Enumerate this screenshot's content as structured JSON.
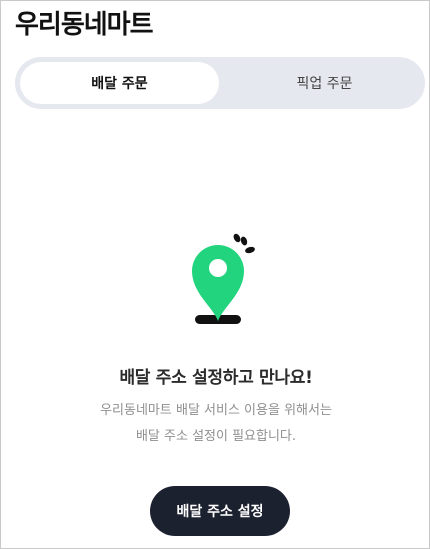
{
  "app": {
    "title": "우리동네마트"
  },
  "tabs": [
    {
      "label": "배달 주문",
      "active": true
    },
    {
      "label": "픽업 주문",
      "active": false
    }
  ],
  "empty_state": {
    "icon": "location-pin-icon",
    "heading": "배달 주소 설정하고 만나요!",
    "description_line1": "우리동네마트 배달 서비스 이용을 위해서는",
    "description_line2": "배달 주소 설정이 필요합니다.",
    "button_label": "배달 주소 설정"
  },
  "colors": {
    "accent_green": "#21d47d",
    "tab_bar_bg": "#e5e8ef",
    "button_bg": "#1c2130",
    "icon_dark": "#111111"
  }
}
